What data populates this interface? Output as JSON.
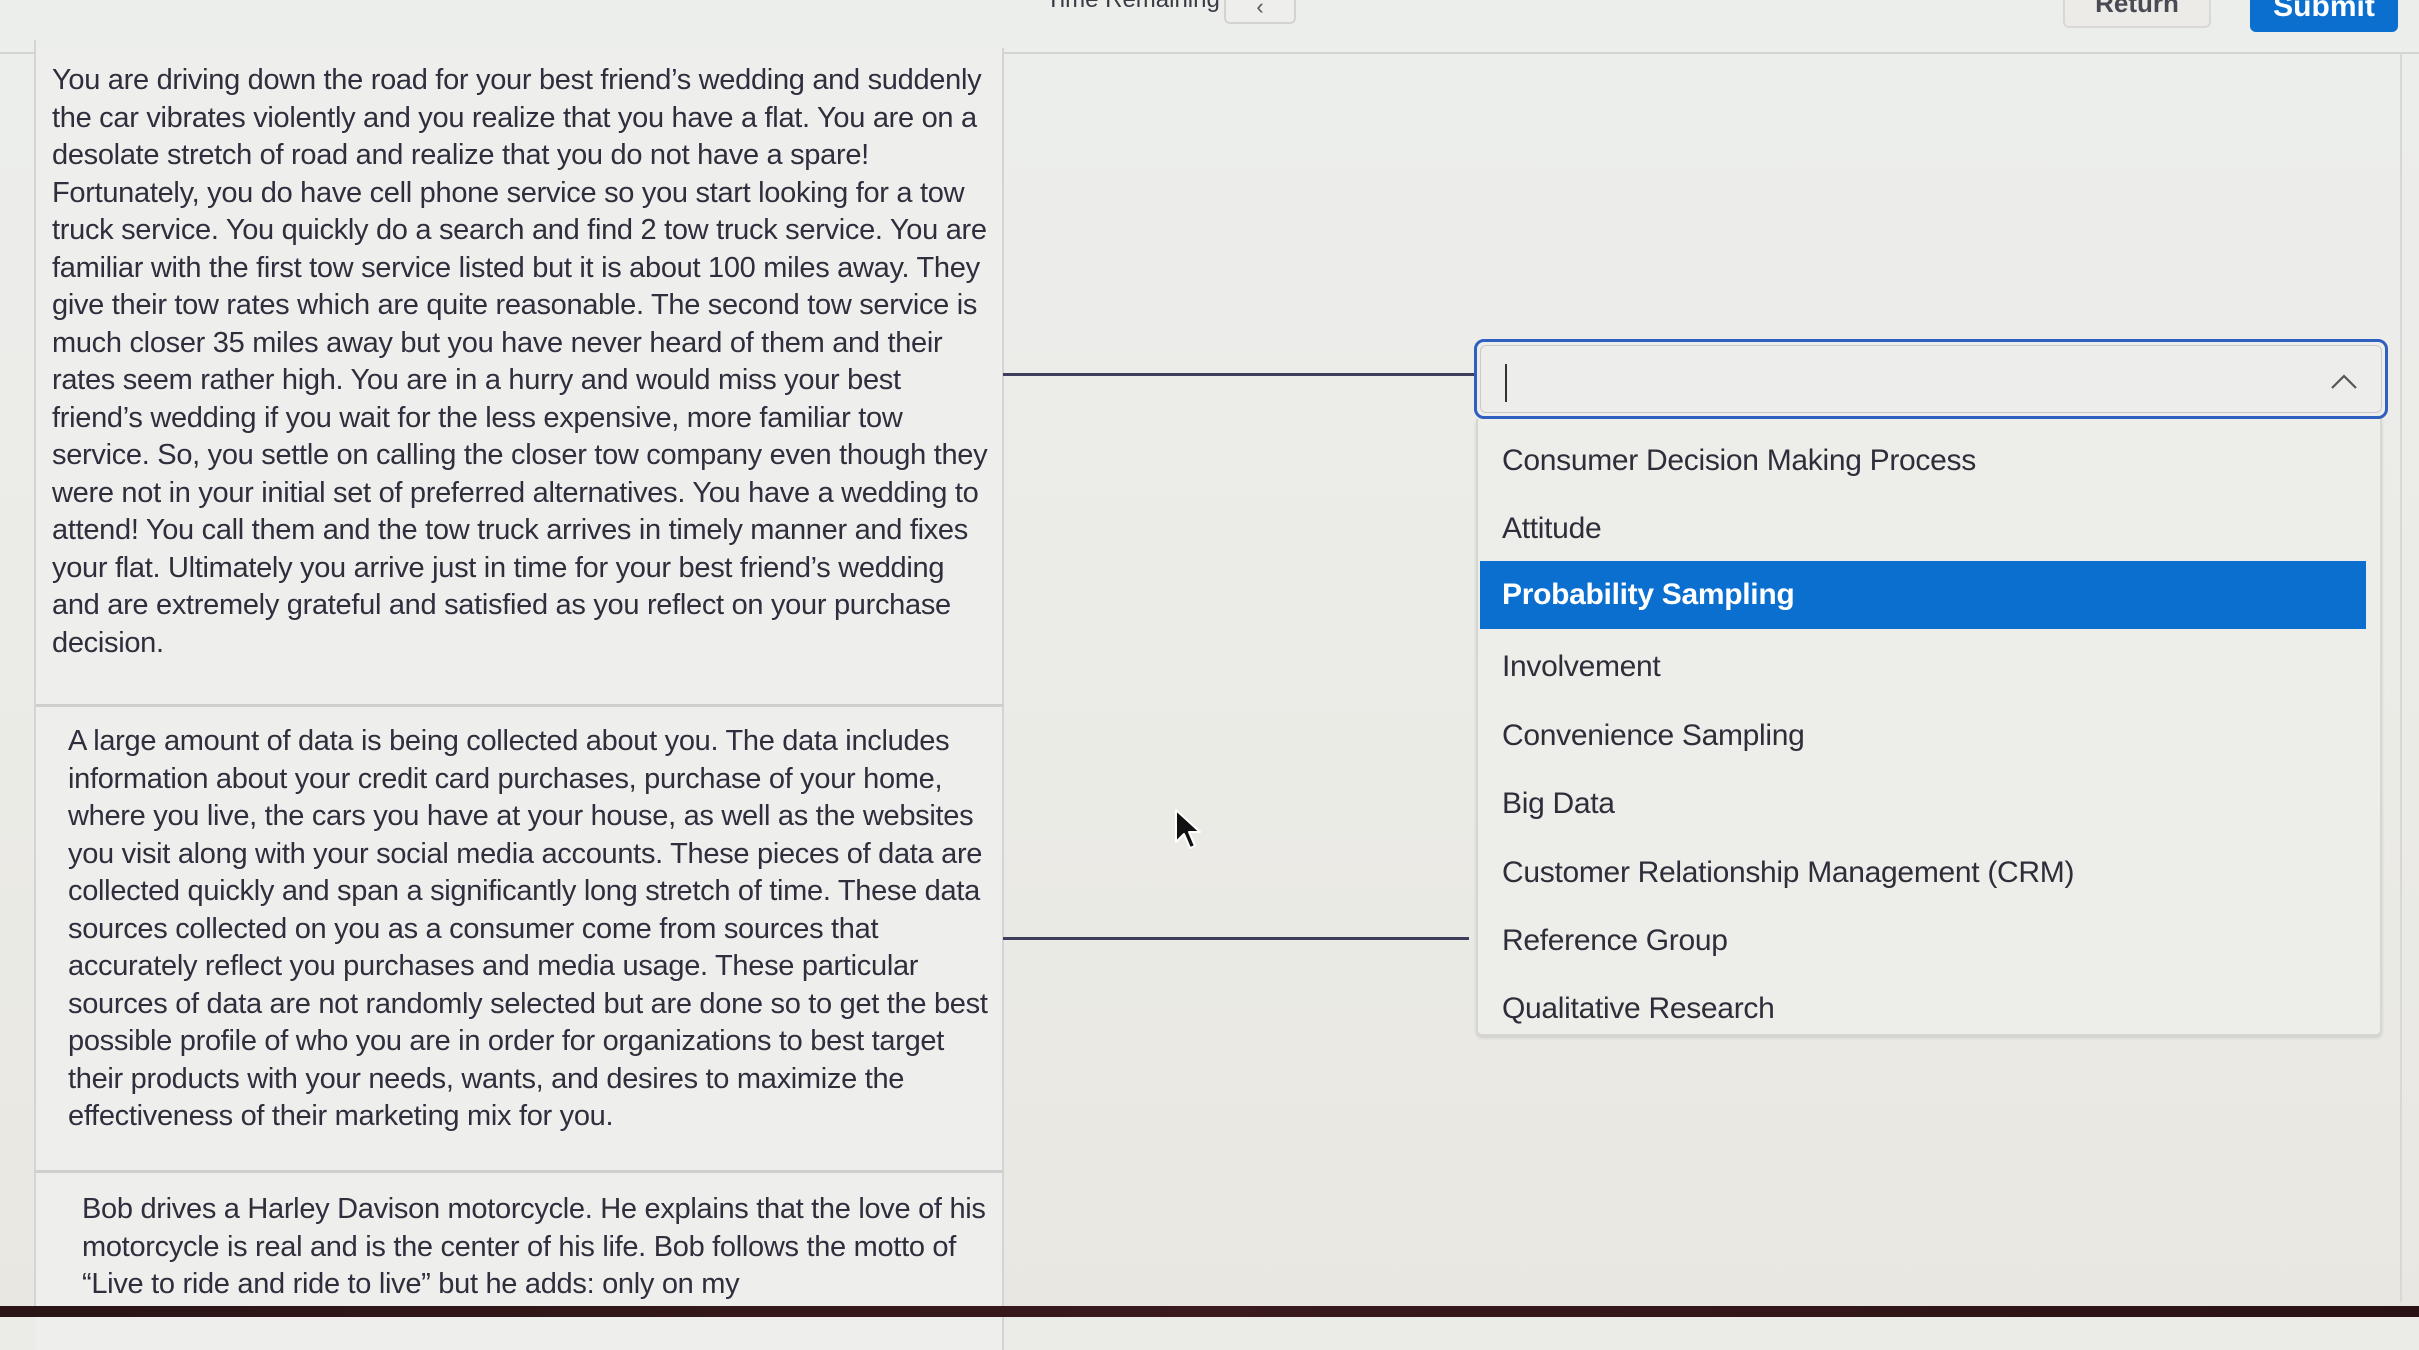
{
  "header": {
    "time_remaining_label": "Time Remaining",
    "collapse_icon": "chevron-left-icon",
    "return_label": "Return",
    "submit_label": "Submit"
  },
  "colors": {
    "accent": "#0b6fcf",
    "focus_border": "#2f5fbf",
    "connector": "#3f3d5c"
  },
  "prompts": [
    {
      "text": "You are driving down the road for your best friend’s wedding and suddenly the car vibrates violently and you realize that you have a flat. You are on a desolate stretch of road and realize that you do not have a spare! Fortunately, you do have cell phone service so you start looking for a tow truck service. You quickly do a search and find 2 tow truck service. You are familiar with the first tow service listed but it is about 100 miles away. They give their tow rates which are quite reasonable. The second tow service is much closer 35 miles away but you have never heard of them and their rates seem rather high. You are in a hurry and would miss your best friend’s wedding if you wait for the less expensive, more familiar tow service. So, you settle on calling the closer tow company even though they were not in your initial set of preferred alternatives. You have a wedding to attend! You call them and the tow truck arrives in timely manner and fixes your flat. Ultimately you arrive just in time for your best friend’s wedding and are extremely grateful and satisfied as you reflect on your purchase decision."
    },
    {
      "text": "A large amount of data is being collected about you. The data includes information about your credit card purchases, purchase of your home, where you live, the cars you have at your house, as well as the websites you visit along with your social media accounts. These pieces of data are collected quickly and span a significantly long stretch of time. These data sources collected on you as a consumer come from sources that accurately reflect you purchases and media usage. These particular sources of data are not randomly selected but are done so to get the best possible profile of who you are in order for organizations to best target their products with your needs, wants, and desires to maximize the effectiveness of their marketing mix for you."
    },
    {
      "text": "Bob drives a Harley Davison motorcycle. He explains that the love of his motorcycle is real and is the center of his life. Bob follows the motto of “Live to ride and ride to live” but he adds: only on my"
    }
  ],
  "dropdown": {
    "value": "",
    "expanded": true,
    "chevron_icon": "chevron-up-icon",
    "highlighted_index": 2,
    "options": [
      "Consumer Decision Making Process",
      "Attitude",
      "Probability Sampling",
      "Involvement",
      "Convenience Sampling",
      "Big Data",
      "Customer Relationship Management (CRM)",
      "Reference Group",
      "Qualitative Research"
    ]
  }
}
